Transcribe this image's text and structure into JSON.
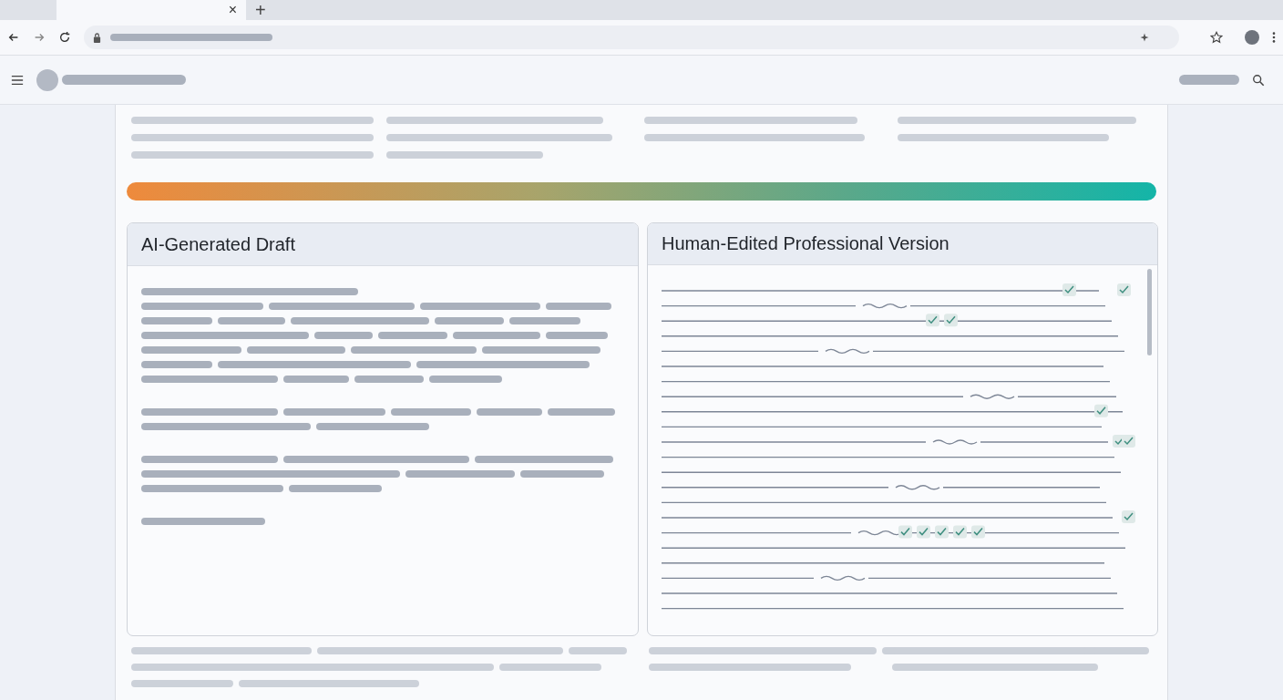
{
  "browser": {
    "tab_close": "×",
    "new_tab": "+"
  },
  "panels": [
    {
      "title": "AI-Generated Draft",
      "kind": "draft"
    },
    {
      "title": "Human-Edited Professional Version",
      "kind": "edited"
    }
  ]
}
